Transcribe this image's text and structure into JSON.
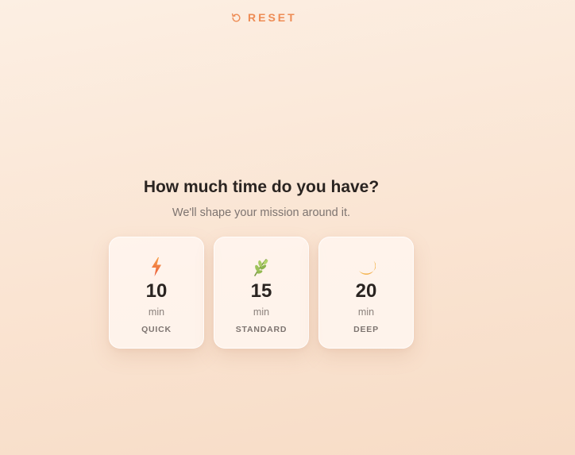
{
  "header": {
    "reset_label": "RESET",
    "reset_icon": "rotate-ccw-icon"
  },
  "main": {
    "title": "How much time do you have?",
    "subtitle": "We'll shape your mission around it.",
    "options": [
      {
        "value": "10",
        "unit": "min",
        "label": "QUICK",
        "icon": "lightning-icon"
      },
      {
        "value": "15",
        "unit": "min",
        "label": "STANDARD",
        "icon": "leaf-icon"
      },
      {
        "value": "20",
        "unit": "min",
        "label": "DEEP",
        "icon": "moon-icon"
      }
    ]
  },
  "colors": {
    "accent": "#ee8c55",
    "text_primary": "#2a2421",
    "text_secondary": "#7d7470",
    "card_background": "#fff6f0",
    "page_background": "#fae4d2"
  }
}
